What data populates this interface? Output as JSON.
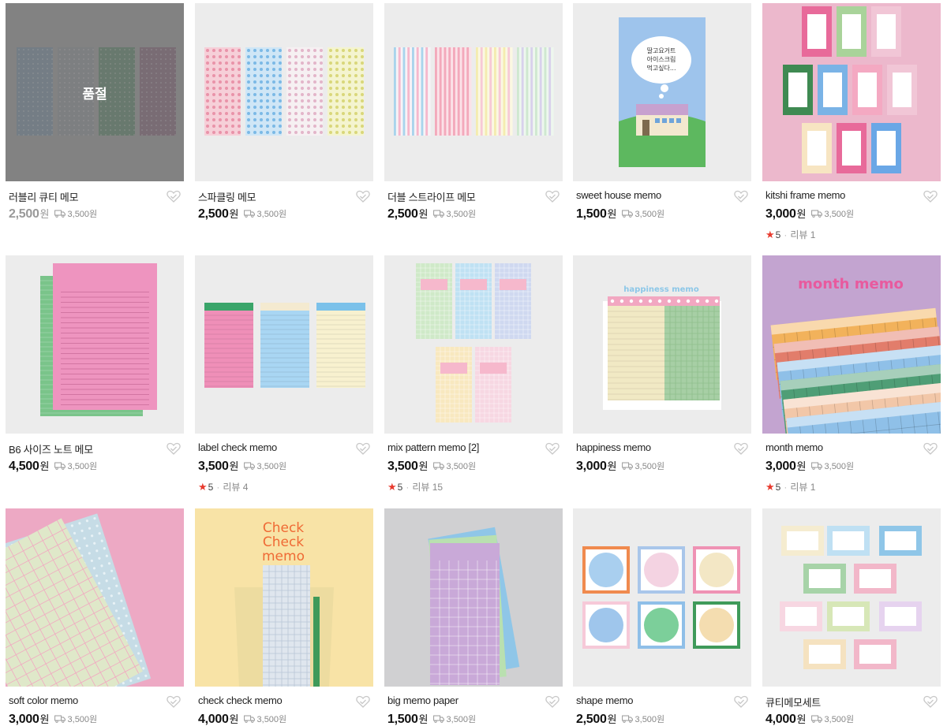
{
  "products": [
    {
      "name": "러블리 큐티 메모",
      "price": "2,500",
      "currency": "원",
      "shipping": "3,500원",
      "sold_out": true,
      "sold_out_label": "품절",
      "thumb_bg": "#9a9a9a"
    },
    {
      "name": "스파클링 메모",
      "price": "2,500",
      "currency": "원",
      "shipping": "3,500원",
      "thumb_bg": "#ececec"
    },
    {
      "name": "더블 스트라이프 메모",
      "price": "2,500",
      "currency": "원",
      "shipping": "3,500원",
      "thumb_bg": "#ececec"
    },
    {
      "name": "sweet house memo",
      "price": "1,500",
      "currency": "원",
      "shipping": "3,500원",
      "thumb_bg": "#ececec",
      "thumb_text": [
        "딸고요거트",
        "아이스크림",
        "먹고싶다..."
      ]
    },
    {
      "name": "kitshi frame memo",
      "price": "3,000",
      "currency": "원",
      "shipping": "3,500원",
      "thumb_bg": "#ecb8cc",
      "rating": "5",
      "review_label": "리뷰 1"
    },
    {
      "name": "B6 사이즈 노트 메모",
      "price": "4,500",
      "currency": "원",
      "shipping": "3,500원",
      "thumb_bg": "#ececec"
    },
    {
      "name": "label check memo",
      "price": "3,500",
      "currency": "원",
      "shipping": "3,500원",
      "thumb_bg": "#ececec",
      "rating": "5",
      "review_label": "리뷰 4"
    },
    {
      "name": "mix pattern memo [2]",
      "price": "3,500",
      "currency": "원",
      "shipping": "3,500원",
      "thumb_bg": "#ececec",
      "rating": "5",
      "review_label": "리뷰 15"
    },
    {
      "name": "happiness memo",
      "price": "3,000",
      "currency": "원",
      "shipping": "3,500원",
      "thumb_bg": "#ececec",
      "thumb_text": [
        "happiness memo"
      ]
    },
    {
      "name": "month memo",
      "price": "3,000",
      "currency": "원",
      "shipping": "3,500원",
      "thumb_bg": "#c3a4d0",
      "rating": "5",
      "review_label": "리뷰 1",
      "thumb_text": [
        "month memo"
      ]
    },
    {
      "name": "soft color memo",
      "price": "3,000",
      "currency": "원",
      "shipping": "3,500원",
      "thumb_bg": "#eda9c4"
    },
    {
      "name": "check check memo",
      "price": "4,000",
      "currency": "원",
      "shipping": "3,500원",
      "thumb_bg": "#f8e3a6",
      "thumb_text": [
        "Check",
        "Check",
        "memo"
      ]
    },
    {
      "name": "big memo paper",
      "price": "1,500",
      "currency": "원",
      "shipping": "3,500원",
      "thumb_bg": "#d0d0d2"
    },
    {
      "name": "shape memo",
      "price": "2,500",
      "currency": "원",
      "shipping": "3,500원",
      "thumb_bg": "#ececec"
    },
    {
      "name": "큐티메모세트",
      "price": "4,000",
      "currency": "원",
      "shipping": "3,500원",
      "thumb_bg": "#ececec"
    }
  ],
  "icons": {
    "wishlist": "heart-outline-icon",
    "shipping": "delivery-truck-icon",
    "rating": "star-icon"
  },
  "colors": {
    "star": "#e83a2e",
    "price": "#111111",
    "muted": "#999999"
  }
}
